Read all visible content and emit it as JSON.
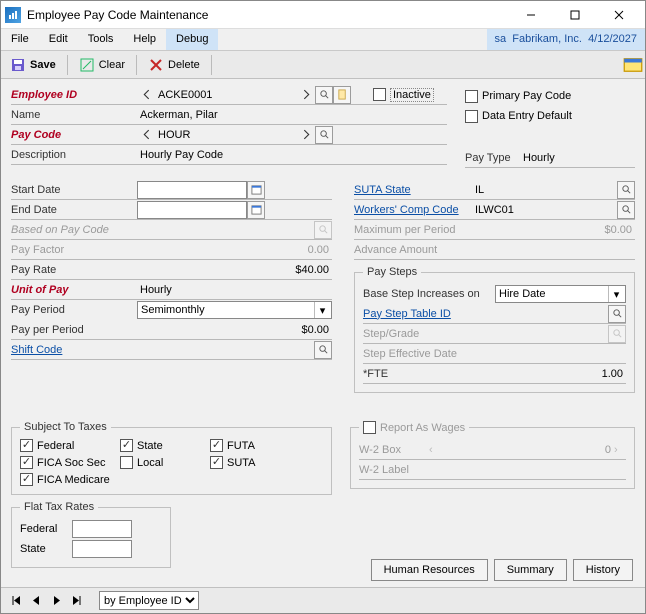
{
  "window": {
    "title": "Employee Pay Code Maintenance"
  },
  "menubar": {
    "file": "File",
    "edit": "Edit",
    "tools": "Tools",
    "help": "Help",
    "debug": "Debug",
    "context_user": "sa",
    "context_company": "Fabrikam, Inc.",
    "context_date": "4/12/2027"
  },
  "toolbar": {
    "save": "Save",
    "clear": "Clear",
    "delete": "Delete"
  },
  "labels": {
    "employee_id": "Employee ID",
    "name": "Name",
    "pay_code": "Pay Code",
    "description": "Description",
    "inactive": "Inactive",
    "primary_pay_code": "Primary Pay Code",
    "data_entry_default": "Data Entry Default",
    "pay_type": "Pay Type",
    "start_date": "Start Date",
    "end_date": "End Date",
    "based_on": "Based on Pay Code",
    "pay_factor": "Pay Factor",
    "pay_rate": "Pay Rate",
    "unit_of_pay": "Unit of Pay",
    "pay_period": "Pay Period",
    "pay_per_period": "Pay per Period",
    "shift_code": "Shift Code",
    "suta_state": "SUTA State",
    "wc_code": "Workers' Comp Code",
    "max_per_period": "Maximum per Period",
    "advance_amount": "Advance Amount",
    "pay_steps": "Pay Steps",
    "base_step": "Base Step Increases on",
    "pay_step_table": "Pay Step Table ID",
    "step_grade": "Step/Grade",
    "step_eff": "Step Effective Date",
    "fte": "*FTE",
    "subject_taxes": "Subject To Taxes",
    "federal": "Federal",
    "state": "State",
    "futa": "FUTA",
    "fica_ss": "FICA Soc Sec",
    "local": "Local",
    "suta": "SUTA",
    "fica_med": "FICA Medicare",
    "flat_tax": "Flat Tax Rates",
    "flat_federal": "Federal",
    "flat_state": "State",
    "report_wages": "Report As Wages",
    "w2_box": "W-2 Box",
    "w2_label": "W-2 Label"
  },
  "values": {
    "employee_id": "ACKE0001",
    "name": "Ackerman, Pilar",
    "pay_code": "HOUR",
    "description": "Hourly Pay Code",
    "pay_type": "Hourly",
    "start_date": "",
    "end_date": "",
    "based_on": "",
    "pay_factor": "0.00",
    "pay_rate": "$40.00",
    "unit_of_pay": "Hourly",
    "pay_period": "Semimonthly",
    "pay_per_period": "$0.00",
    "shift_code": "",
    "suta_state": "IL",
    "wc_code": "ILWC01",
    "max_per_period": "$0.00",
    "advance_amount": "",
    "base_step": "Hire Date",
    "pay_step_table": "",
    "step_grade": "",
    "step_eff": "",
    "fte": "1.00",
    "w2_box": "0",
    "w2_label": ""
  },
  "checks": {
    "inactive": false,
    "primary_pay_code": false,
    "data_entry_default": false,
    "federal": true,
    "state": true,
    "futa": true,
    "fica_ss": true,
    "local": false,
    "suta": true,
    "fica_med": true,
    "report_wages": false
  },
  "buttons": {
    "hr": "Human Resources",
    "summary": "Summary",
    "history": "History"
  },
  "footer": {
    "sort_by": "by Employee ID"
  }
}
